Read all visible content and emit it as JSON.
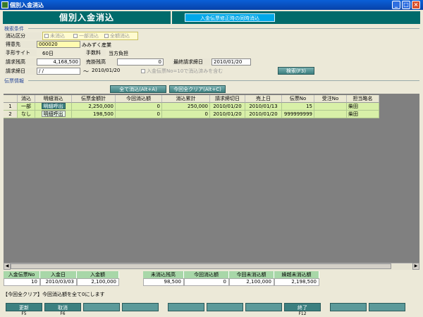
{
  "window": {
    "title": "個別入金消込"
  },
  "header": {
    "title": "個別入金消込",
    "note": "入金伝票修正時の同時消込"
  },
  "search": {
    "group_label": "検索条件",
    "kbn_label": "消込区分",
    "kbn_opts": [
      "未消込",
      "一部消込",
      "全額消込"
    ],
    "customer_label": "得意先",
    "customer_code": "000020",
    "customer_name": "みみずく産業",
    "tegata_label": "手形サイト",
    "tegata_value": "60日",
    "fee_label": "手数料",
    "fee_value": "当方負担",
    "balance_label": "請求残高",
    "balance_value": "4,168,500",
    "urikake_label": "売掛残高",
    "urikake_value": "0",
    "last_date_label": "最終請求締日",
    "last_date_value": "2010/01/20",
    "seikyu_label": "請求締日",
    "seikyu_from": "/  /",
    "tilde": "〜",
    "seikyu_to": "2010/01/20",
    "include_label": "入金伝票No=10で消込済みを含む",
    "search_btn": "検索(F3)"
  },
  "invoice": {
    "group_label": "伝票情報",
    "btn_all": "全て消込(Alt+A)",
    "btn_clear": "今回全クリア(Alt+C)",
    "columns": [
      "消込",
      "明細消込",
      "伝票金額計",
      "今回消込額",
      "消込累計",
      "請求締切日",
      "売上日",
      "伝票No",
      "受注No",
      "担当略名"
    ],
    "rows": [
      {
        "num": "1",
        "status": "一部",
        "btn": "明細呼出",
        "amount": "2,250,000",
        "this_amt": "0",
        "cumulative": "250,000",
        "close_date": "2010/01/20",
        "sales_date": "2010/01/13",
        "slip_no": "15",
        "order_no": "",
        "staff": "柴田"
      },
      {
        "num": "2",
        "status": "なし",
        "btn": "明細呼出",
        "amount": "198,500",
        "this_amt": "0",
        "cumulative": "0",
        "close_date": "2010/01/20",
        "sales_date": "2010/01/20",
        "slip_no": "999999999",
        "order_no": "",
        "staff": "柴田"
      }
    ]
  },
  "summary": {
    "h": [
      "入金伝票No",
      "入金日",
      "入金額",
      "未消込残高",
      "今回消込額",
      "今回未消込額",
      "繰越未消込額"
    ],
    "v": [
      "10",
      "2010/03/03",
      "2,100,000",
      "98,500",
      "0",
      "2,100,000",
      "2,198,500"
    ]
  },
  "status_message": "【今回全クリア】今回消込額を全て0にします",
  "fkeys": [
    {
      "label": "更新",
      "key": "F5"
    },
    {
      "label": "取消",
      "key": "F6"
    },
    {
      "label": "",
      "key": ""
    },
    {
      "label": "",
      "key": ""
    },
    {
      "label": "",
      "key": ""
    },
    {
      "label": "",
      "key": ""
    },
    {
      "label": "",
      "key": ""
    },
    {
      "label": "終了",
      "key": "F12"
    },
    {
      "label": "",
      "key": ""
    },
    {
      "label": "",
      "key": ""
    }
  ]
}
